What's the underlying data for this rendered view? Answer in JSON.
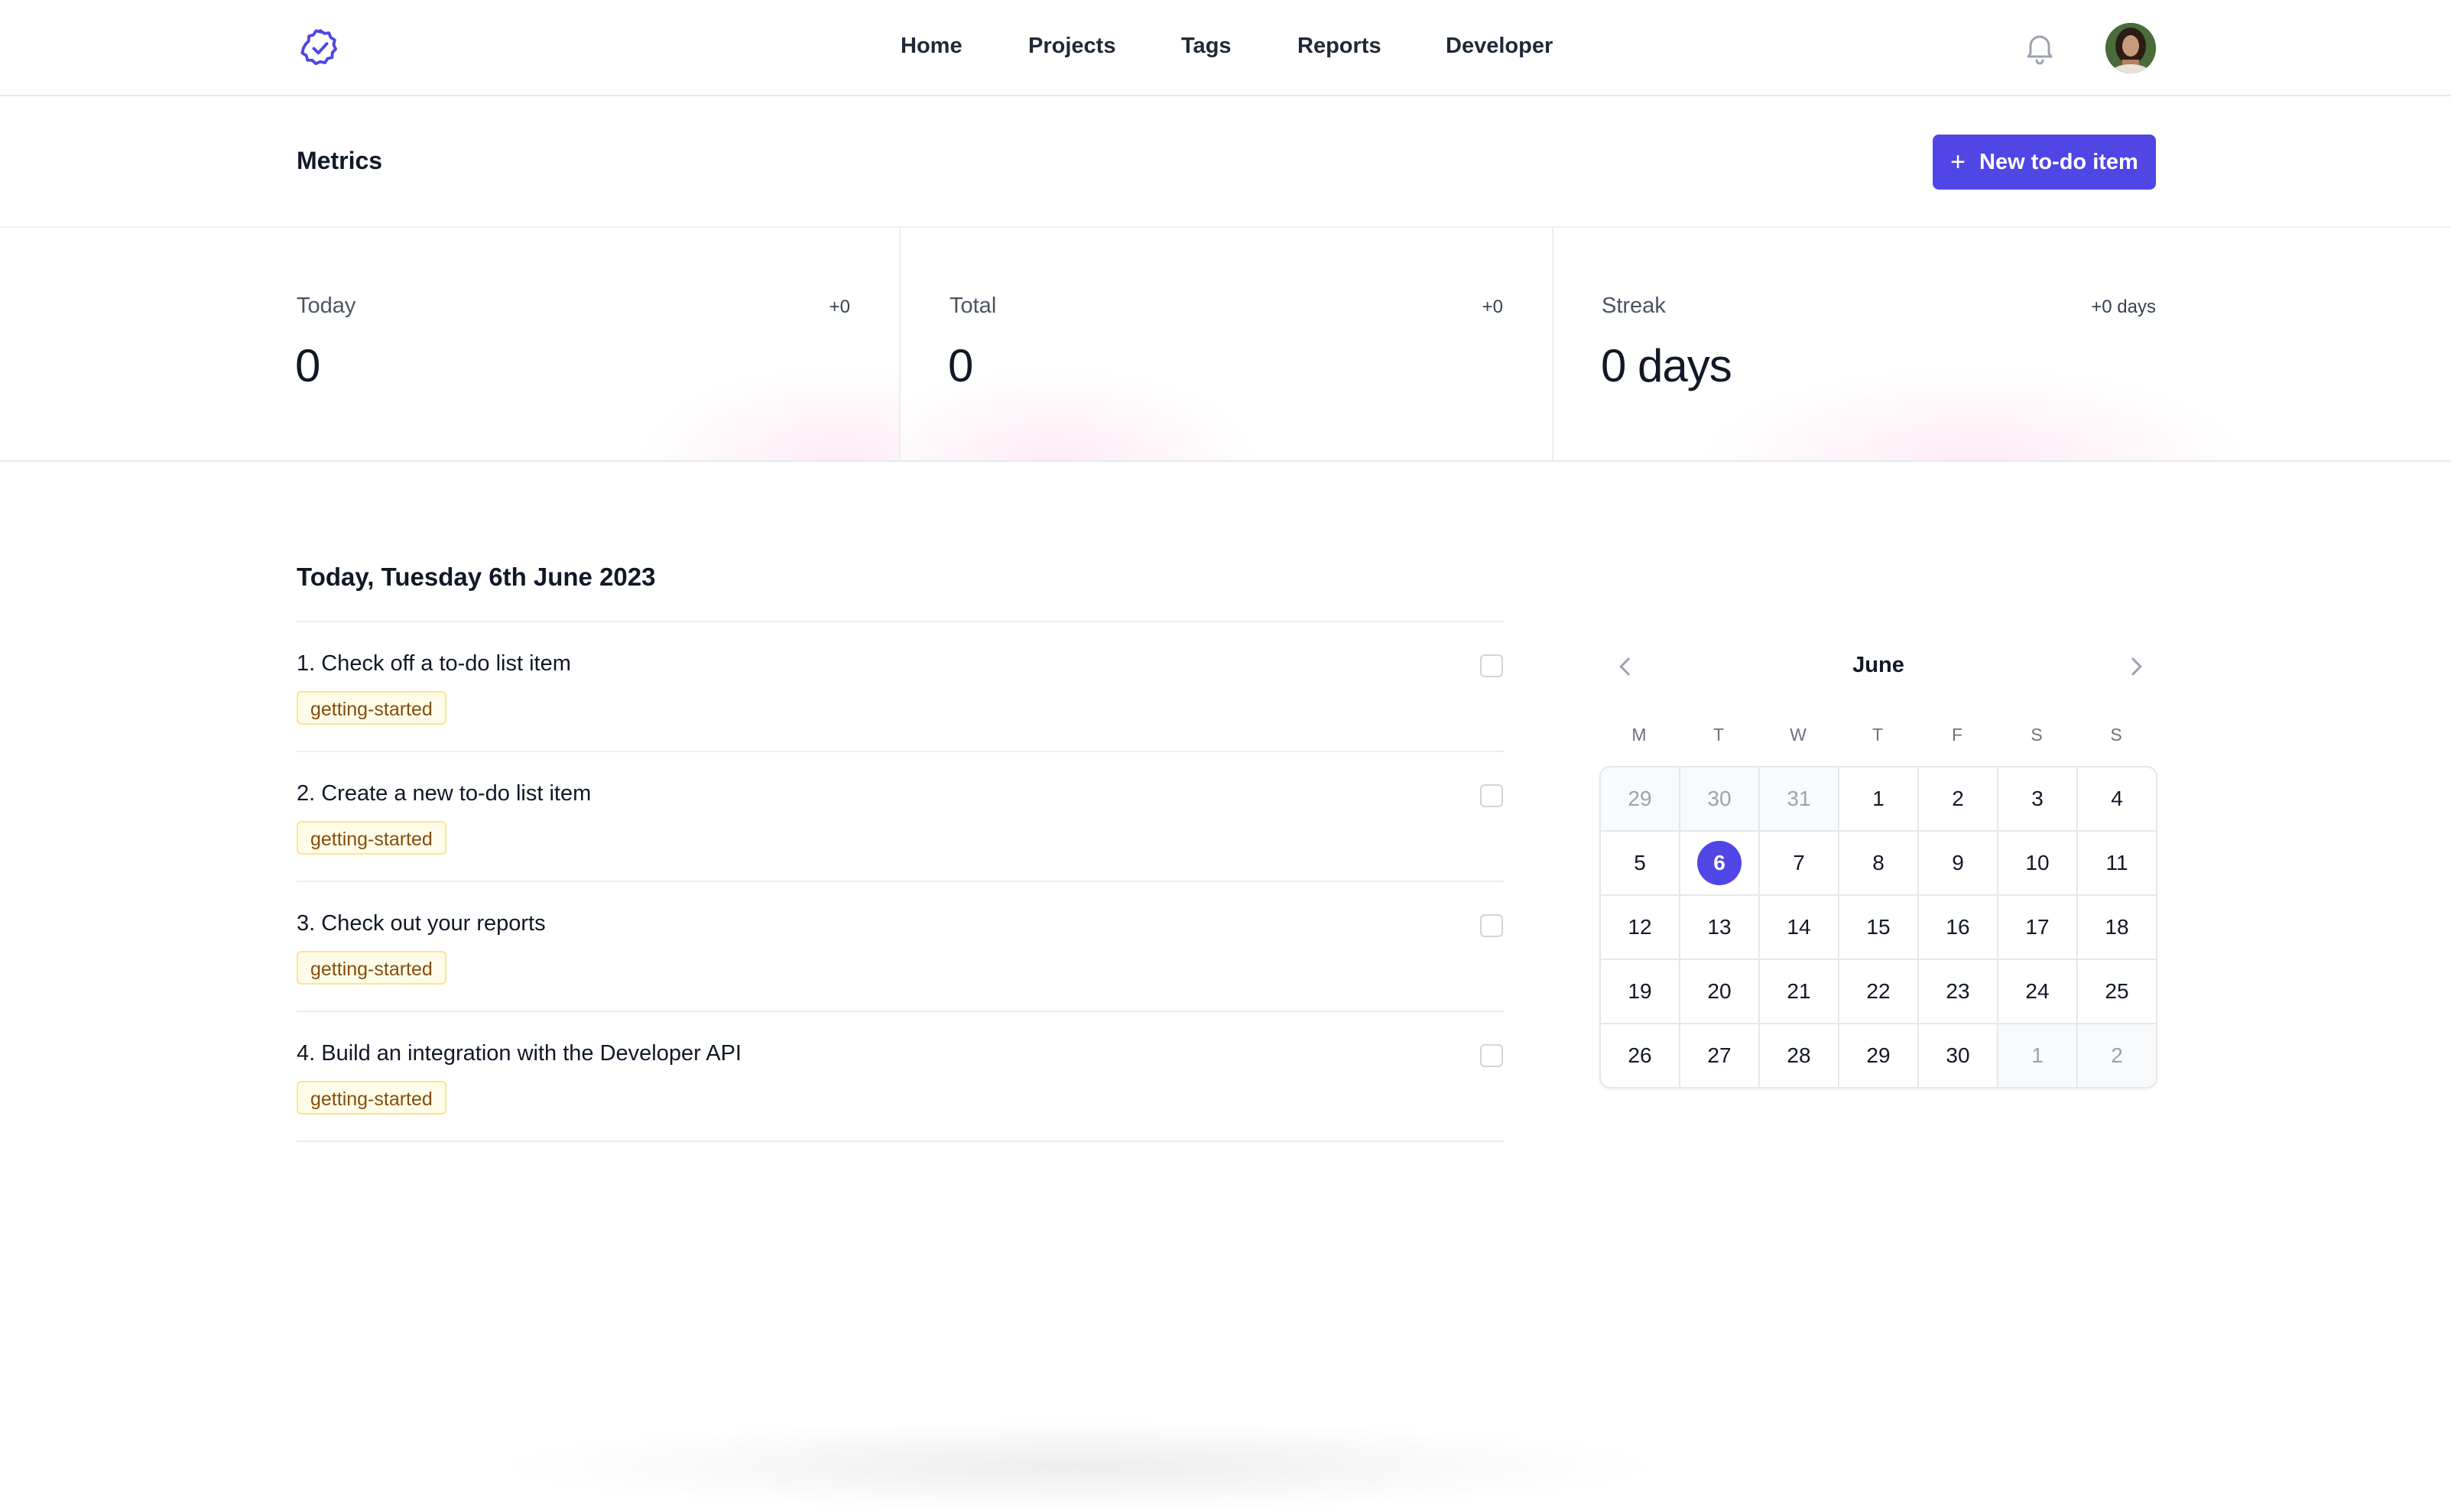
{
  "nav": {
    "items": [
      {
        "label": "Home"
      },
      {
        "label": "Projects"
      },
      {
        "label": "Tags"
      },
      {
        "label": "Reports"
      },
      {
        "label": "Developer"
      }
    ]
  },
  "header": {
    "title": "Metrics",
    "new_button_label": "New to-do item"
  },
  "stats": [
    {
      "label": "Today",
      "value": "0",
      "delta": "+0"
    },
    {
      "label": "Total",
      "value": "0",
      "delta": "+0"
    },
    {
      "label": "Streak",
      "value": "0 days",
      "delta": "+0 days"
    }
  ],
  "today": {
    "title": "Today, Tuesday 6th June 2023",
    "items": [
      {
        "text": "1. Check off a to-do list item",
        "tag": "getting-started"
      },
      {
        "text": "2. Create a new to-do list item",
        "tag": "getting-started"
      },
      {
        "text": "3. Check out your reports",
        "tag": "getting-started"
      },
      {
        "text": "4. Build an integration with the Developer API",
        "tag": "getting-started"
      }
    ]
  },
  "calendar": {
    "month": "June",
    "weekdays": [
      "M",
      "T",
      "W",
      "T",
      "F",
      "S",
      "S"
    ],
    "selected": "6",
    "days": [
      {
        "d": "29",
        "other": true
      },
      {
        "d": "30",
        "other": true
      },
      {
        "d": "31",
        "other": true
      },
      {
        "d": "1"
      },
      {
        "d": "2"
      },
      {
        "d": "3"
      },
      {
        "d": "4"
      },
      {
        "d": "5"
      },
      {
        "d": "6"
      },
      {
        "d": "7"
      },
      {
        "d": "8"
      },
      {
        "d": "9"
      },
      {
        "d": "10"
      },
      {
        "d": "11"
      },
      {
        "d": "12"
      },
      {
        "d": "13"
      },
      {
        "d": "14"
      },
      {
        "d": "15"
      },
      {
        "d": "16"
      },
      {
        "d": "17"
      },
      {
        "d": "18"
      },
      {
        "d": "19"
      },
      {
        "d": "20"
      },
      {
        "d": "21"
      },
      {
        "d": "22"
      },
      {
        "d": "23"
      },
      {
        "d": "24"
      },
      {
        "d": "25"
      },
      {
        "d": "26"
      },
      {
        "d": "27"
      },
      {
        "d": "28"
      },
      {
        "d": "29"
      },
      {
        "d": "30"
      },
      {
        "d": "1",
        "other": true
      },
      {
        "d": "2",
        "other": true
      }
    ]
  },
  "colors": {
    "accent": "#4f46e5",
    "tag_bg": "#fefce8",
    "tag_text": "#854d0e"
  },
  "icons": {
    "logo": "badge-check-icon",
    "notifications": "bell-icon",
    "plus": "plus-icon",
    "prev": "chevron-left-icon",
    "next": "chevron-right-icon"
  }
}
